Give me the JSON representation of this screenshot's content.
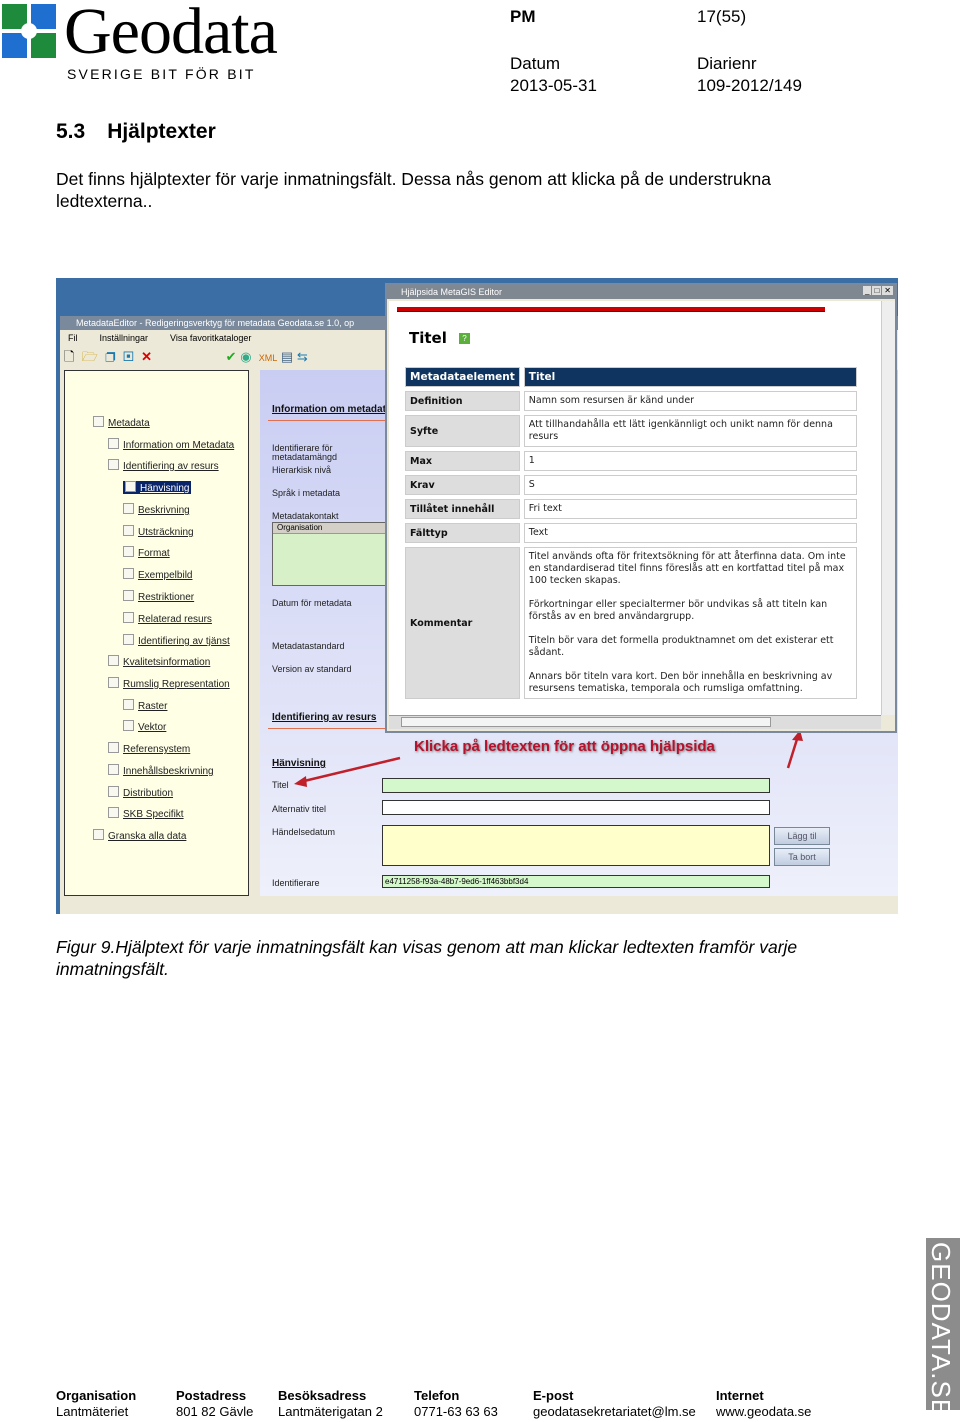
{
  "header": {
    "logo_text": "Geodata",
    "logo_tagline": "SVERIGE BIT FÖR BIT",
    "doc_type": "PM",
    "page": "17(55)",
    "date_label": "Datum",
    "date": "2013-05-31",
    "reg_label": "Diarienr",
    "reg": "109-2012/149"
  },
  "section": {
    "number": "5.3",
    "title": "Hjälptexter",
    "paragraph": "Det finns hjälptexter för varje inmatningsfält. Dessa nås genom att klicka på de understrukna ledtexterna.."
  },
  "app": {
    "title": "MetadataEditor - Redigeringsverktyg för metadata Geodata.se 1.0, op",
    "menu": [
      "Fil",
      "Inställningar",
      "Visa favoritkataloger"
    ],
    "tree": [
      {
        "label": "Metadata",
        "level": 0
      },
      {
        "label": "Information om Metadata",
        "level": 1
      },
      {
        "label": "Identifiering av resurs",
        "level": 1
      },
      {
        "label": "Hänvisning",
        "level": 2,
        "selected": true
      },
      {
        "label": "Beskrivning",
        "level": 2
      },
      {
        "label": "Utsträckning",
        "level": 2
      },
      {
        "label": "Format",
        "level": 2
      },
      {
        "label": "Exempelbild",
        "level": 2
      },
      {
        "label": "Restriktioner",
        "level": 2
      },
      {
        "label": "Relaterad resurs",
        "level": 2
      },
      {
        "label": "Identifiering av tjänst",
        "level": 2
      },
      {
        "label": "Kvalitetsinformation",
        "level": 1
      },
      {
        "label": "Rumslig Representation",
        "level": 1
      },
      {
        "label": "Raster",
        "level": 2
      },
      {
        "label": "Vektor",
        "level": 2
      },
      {
        "label": "Referensystem",
        "level": 1
      },
      {
        "label": "Innehållsbeskrivning",
        "level": 1
      },
      {
        "label": "Distribution",
        "level": 1
      },
      {
        "label": "SKB Specifikt",
        "level": 1
      },
      {
        "label": "Granska alla data",
        "level": 0
      }
    ],
    "form": {
      "section1": "Information om metadata",
      "fields1": [
        "Identifierare för metadatamängd",
        "Hierarkisk nivå",
        "Språk i metadata",
        "Metadatakontakt"
      ],
      "grid_header": "Organisation",
      "fields1b": [
        "Datum för metadata",
        "Metadatastandard",
        "Version av standard"
      ],
      "section2": "Identifiering av resurs",
      "subsection": "Hänvisning",
      "fields2": [
        "Titel",
        "Alternativ titel",
        "Händelsedatum",
        "Identifierare"
      ],
      "identifier_value": "e4711258-f93a-48b7-9ed6-1ff463bbf3d4",
      "add_button": "Lägg til",
      "remove_button": "Ta bort"
    },
    "annotation": "Klicka på ledtexten för att öppna hjälpsida"
  },
  "help": {
    "window_title": "Hjälpsida MetaGIS Editor",
    "heading": "Titel",
    "rows": [
      {
        "key": "Metadataelement",
        "value": "Titel"
      },
      {
        "key": "Definition",
        "value": "Namn som resursen är känd under"
      },
      {
        "key": "Syfte",
        "value": "Att tillhandahålla ett lätt igenkännligt och unikt namn för denna resurs"
      },
      {
        "key": "Max",
        "value": "1"
      },
      {
        "key": "Krav",
        "value": "S"
      },
      {
        "key": "Tillåtet innehåll",
        "value": "Fri text"
      },
      {
        "key": "Fälttyp",
        "value": "Text"
      }
    ],
    "comment_key": "Kommentar",
    "comment": [
      "Titel används ofta för fritextsökning för att återfinna data. Om inte en standardiserad titel finns föreslås att en kortfattad titel på max 100 tecken skapas.",
      "Förkortningar eller specialtermer bör undvikas så att titeln kan förstås av en bred användargrupp.",
      "Titeln bör vara det formella produktnamnet om det existerar ett sådant.",
      "Annars bör titeln vara kort. Den bör innehålla en beskrivning av resursens tematiska, temporala och rumsliga omfattning."
    ]
  },
  "caption": "Figur 9.Hjälptext för varje inmatningsfält kan visas genom att man klickar ledtexten framför varje inmatningsfält.",
  "footer": [
    {
      "label": "Organisation",
      "value": "Lantmäteriet"
    },
    {
      "label": "Postadress",
      "value": "801 82 Gävle"
    },
    {
      "label": "Besöksadress",
      "value": "Lantmäterigatan 2"
    },
    {
      "label": "Telefon",
      "value": "0771-63 63 63"
    },
    {
      "label": "E-post",
      "value": "geodatasekretariatet@lm.se"
    },
    {
      "label": "Internet",
      "value": "www.geodata.se"
    }
  ],
  "side_brand": "GEODATA.SE",
  "colors": {
    "logo_blue": "#1f6fd1",
    "logo_green": "#1e8a3c",
    "window_bg": "#3a6ea5",
    "help_header": "#0f3460",
    "annotation": "#b5122e"
  }
}
